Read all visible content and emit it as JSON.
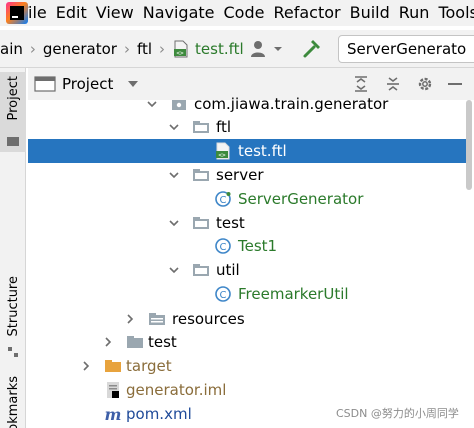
{
  "menubar": {
    "items": [
      "File",
      "Edit",
      "View",
      "Navigate",
      "Code",
      "Refactor",
      "Build",
      "Run",
      "Tools"
    ]
  },
  "navbar": {
    "crumbs": [
      "ain",
      "generator",
      "ftl",
      "test.ftl"
    ],
    "run_config": "ServerGenerato"
  },
  "stripe": {
    "project_label": "Project",
    "structure_label": "Structure",
    "bookmarks_label": "okmarks"
  },
  "panel": {
    "title": "Project"
  },
  "tree": {
    "package": "com.jiawa.train.generator",
    "ftl": "ftl",
    "test_ftl": "test.ftl",
    "server": "server",
    "server_generator": "ServerGenerator",
    "test_pkg": "test",
    "test1": "Test1",
    "util": "util",
    "freemarker_util": "FreemarkerUtil",
    "resources": "resources",
    "test_dir": "test",
    "target": "target",
    "generator_iml": "generator.iml",
    "pom_xml": "pom.xml"
  },
  "watermark": "CSDN @努力的小周同学",
  "colors": {
    "selection": "#2675bf",
    "class_icon": "#3e86c8",
    "folder": "#9aa7b0",
    "target_folder": "#e8a33d"
  }
}
